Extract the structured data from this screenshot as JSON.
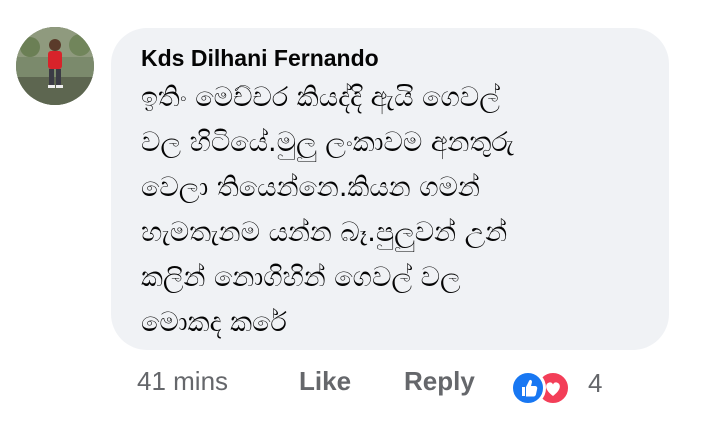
{
  "comment": {
    "author": "Kds Dilhani Fernando",
    "text_lines": [
      "ඉතිං මෙච්චර කියද්දි ඇයි ගෙවල්",
      "වල හිටියේ.මුලු ලංකාවම අනතුරු",
      "වෙලා තියෙන්නෙ.කියන ගමන්",
      "හැමතැනම යන්න බෑ.පුලුවන් උන්",
      "කලින් නොගිහින් ගෙවල් වල",
      "මොකද කරේ"
    ]
  },
  "footer": {
    "time": "41 mins",
    "like_label": "Like",
    "reply_label": "Reply",
    "reaction_count": "4",
    "reaction_icons": [
      "like-icon",
      "love-icon"
    ]
  },
  "colors": {
    "bubble_bg": "#f0f2f5",
    "meta_text": "#65676b",
    "like_blue": "#1877f2",
    "love_red": "#f33e58"
  }
}
